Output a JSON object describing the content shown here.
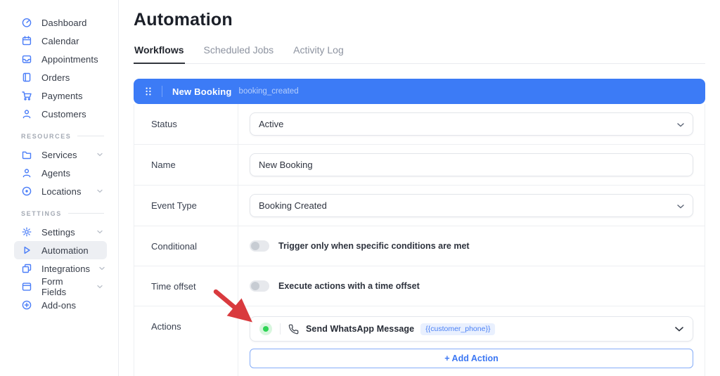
{
  "colors": {
    "accent_blue": "#3c7bf6",
    "icon_blue": "#4a7df8",
    "status_green": "#2fd455",
    "arrow_red": "#d93a3e",
    "badge_bg": "#e9f0fe",
    "badge_text": "#4a80f5"
  },
  "sidebar": {
    "sections": [
      {
        "items": [
          {
            "label": "Dashboard"
          },
          {
            "label": "Calendar"
          },
          {
            "label": "Appointments"
          },
          {
            "label": "Orders"
          },
          {
            "label": "Payments"
          },
          {
            "label": "Customers"
          }
        ]
      },
      {
        "header": "RESOURCES",
        "items": [
          {
            "label": "Services",
            "chevron": true
          },
          {
            "label": "Agents"
          },
          {
            "label": "Locations",
            "chevron": true
          }
        ]
      },
      {
        "header": "SETTINGS",
        "items": [
          {
            "label": "Settings",
            "chevron": true
          },
          {
            "label": "Automation",
            "active": true
          },
          {
            "label": "Integrations",
            "chevron": true
          },
          {
            "label": "Form Fields",
            "chevron": true
          },
          {
            "label": "Add-ons"
          }
        ]
      }
    ]
  },
  "page": {
    "title": "Automation",
    "tabs": [
      {
        "label": "Workflows",
        "active": true
      },
      {
        "label": "Scheduled Jobs",
        "active": false
      },
      {
        "label": "Activity Log",
        "active": false
      }
    ]
  },
  "workflow": {
    "bar": {
      "name": "New Booking",
      "event_code": "booking_created"
    },
    "rows": {
      "status": {
        "label": "Status",
        "value": "Active"
      },
      "name": {
        "label": "Name",
        "value": "New Booking"
      },
      "event_type": {
        "label": "Event Type",
        "value": "Booking Created"
      },
      "conditional": {
        "label": "Conditional",
        "toggle_text": "Trigger only when specific conditions are met",
        "enabled": false
      },
      "time_offset": {
        "label": "Time offset",
        "toggle_text": "Execute actions with a time offset",
        "enabled": false
      },
      "actions": {
        "label": "Actions"
      }
    },
    "action_item": {
      "title": "Send WhatsApp Message",
      "badge": "{{customer_phone}}"
    },
    "add_action_label": "+ Add Action"
  }
}
